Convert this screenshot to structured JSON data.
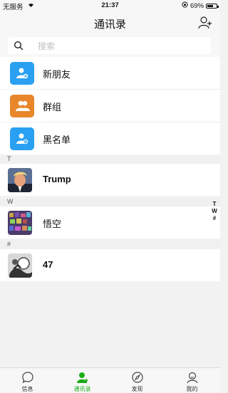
{
  "status_bar": {
    "carrier": "无服务",
    "time": "21:37",
    "battery": "69%",
    "battery_level": 0.69
  },
  "header": {
    "title": "通讯录"
  },
  "search": {
    "placeholder": "搜索"
  },
  "functions": [
    {
      "label": "新朋友",
      "color": "#2aa0f2",
      "icon": "person-add-icon"
    },
    {
      "label": "群组",
      "color": "#e9862a",
      "icon": "group-icon"
    },
    {
      "label": "黑名单",
      "color": "#2aa0f2",
      "icon": "person-block-icon"
    }
  ],
  "sections": [
    {
      "letter": "T",
      "contacts": [
        {
          "name": "Trump"
        }
      ]
    },
    {
      "letter": "W",
      "contacts": [
        {
          "name": "悟空"
        }
      ]
    },
    {
      "letter": "#",
      "contacts": [
        {
          "name": "47"
        }
      ]
    }
  ],
  "index_bar": [
    "T",
    "W",
    "#"
  ],
  "tabs": [
    {
      "label": "信息",
      "icon": "chat-bubble-icon",
      "active": false
    },
    {
      "label": "通讯录",
      "icon": "contacts-icon",
      "active": true
    },
    {
      "label": "发现",
      "icon": "compass-icon",
      "active": false
    },
    {
      "label": "我的",
      "icon": "profile-icon",
      "active": false
    }
  ],
  "colors": {
    "accent_green": "#1aad19",
    "tile_blue": "#2aa0f2",
    "tile_orange": "#e9862a",
    "background": "#f2f2f2"
  }
}
